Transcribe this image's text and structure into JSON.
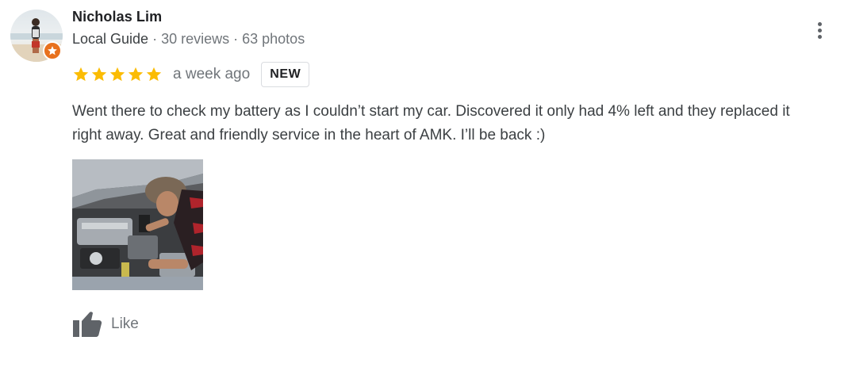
{
  "reviewer": {
    "name": "Nicholas Lim",
    "role": "Local Guide",
    "separator": " · ",
    "reviews": "30 reviews",
    "photos": "63 photos",
    "avatar_icon": "person-avatar",
    "badge_icon": "local-guide-star-icon"
  },
  "review": {
    "rating": 5,
    "rating_max": 5,
    "time_ago": "a week ago",
    "badge": "NEW",
    "text": "Went there to check my battery as I couldn’t start my car. Discovered it only had 4% left and they replaced it right away. Great and friendly service in the heart of AMK. I’ll be back :)",
    "photo_icon": "car-engine-photo"
  },
  "actions": {
    "like_label": "Like",
    "like_icon": "thumbs-up-icon",
    "more_icon": "more-vertical-icon"
  },
  "colors": {
    "star": "#fbbc04",
    "badge": "#e8711d",
    "secondary_text": "#70757a",
    "icon_gray": "#5f6368"
  }
}
